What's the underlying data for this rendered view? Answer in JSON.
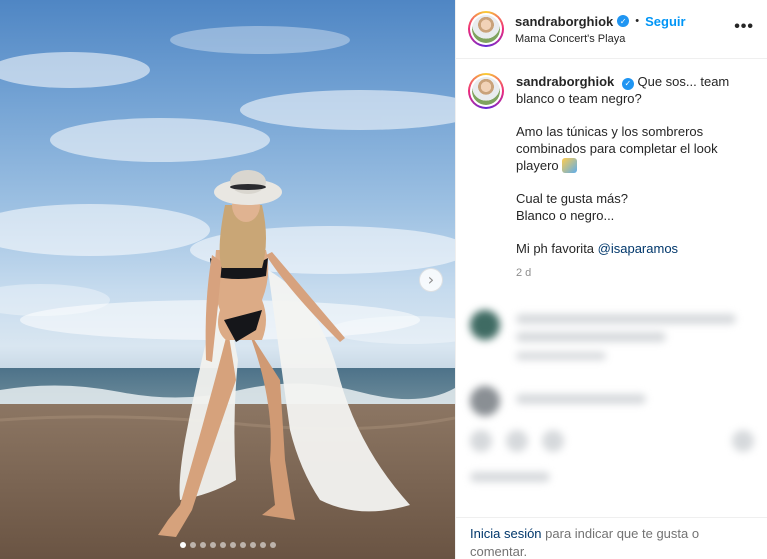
{
  "post": {
    "image_alt": "Mujer en bikini negro y túnica blanca con sombrero en la playa",
    "carousel_dots": 10,
    "active_dot": 0
  },
  "header": {
    "username": "sandraborghiok",
    "separator": "•",
    "follow_label": "Seguir",
    "location": "Mama Concert's Playa",
    "more_label": "•••"
  },
  "caption": {
    "username": "sandraborghiok",
    "line1": "Que sos... team blanco o team negro?",
    "line2": "Amo las túnicas y los sombreros combinados para completar el look playero",
    "line3a": "Cual te gusta más?",
    "line3b": "Blanco o negro...",
    "line4_text": "Mi ph favorita ",
    "line4_mention": "@isaparamos",
    "time": "2 d"
  },
  "footer": {
    "login_link": "Inicia sesión",
    "login_text": " para indicar que te gusta o comentar."
  },
  "icons": {
    "verified": "verified-badge-icon",
    "next": "chevron-right-icon",
    "more": "more-options-icon"
  },
  "colors": {
    "link_blue": "#0095f6",
    "verified_blue": "#1f95f2",
    "mention": "#00376b"
  }
}
